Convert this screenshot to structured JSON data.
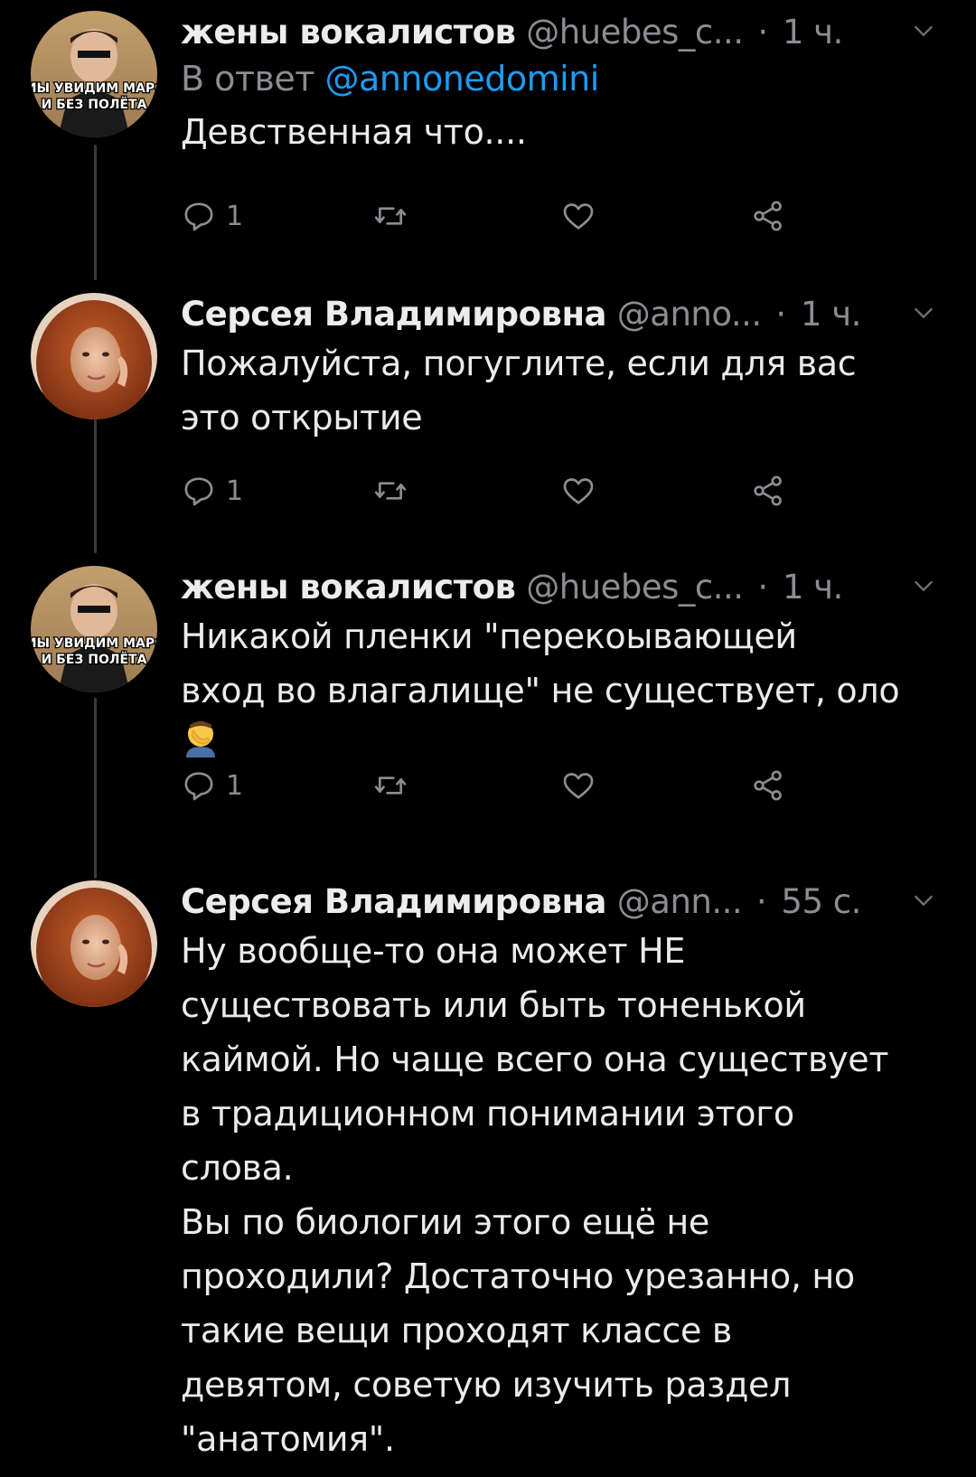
{
  "tweets": [
    {
      "name": "жены вокалистов",
      "handle": "@huebes_c...",
      "time": "1 ч.",
      "reply_to_prefix": "В ответ",
      "reply_to_handle": "@annonedomini",
      "text": "Девственная что....",
      "reply_count": "1",
      "avatar": "musk-meme-avatar",
      "avatar_caption": "МЫ УВИДИМ МАРС\nИ БЕЗ ПОЛЁТА"
    },
    {
      "name": "Серсея Владимировна",
      "handle": "@anno...",
      "time": "1 ч.",
      "text": "Пожалуйста, погуглите, если для вас\nэто открытие",
      "reply_count": "1",
      "avatar": "redhead-woman-avatar"
    },
    {
      "name": "жены вокалистов",
      "handle": "@huebes_c...",
      "time": "1 ч.",
      "text": "Никакой пленки \"перекоывающей\nвход во влагалище\" не существует, оло",
      "emoji": "facepalm-emoji",
      "reply_count": "1",
      "avatar": "musk-meme-avatar",
      "avatar_caption": "МЫ УВИДИМ МАРС\nИ БЕЗ ПОЛЁТА"
    },
    {
      "name": "Серсея Владимировна",
      "handle": "@ann...",
      "time": "55 с.",
      "text": "Ну вообще-то она может НЕ\nсуществовать или быть тоненькой\nкаймой. Но чаще всего она существует\nв традиционном понимании этого\nслова.\nВы по биологии этого ещё не\nпроходили? Достаточно урезанно, но\nтакие вещи проходят классе в\nдевятом, советую изучить раздел\n\"анатомия\".",
      "avatar": "redhead-woman-avatar"
    }
  ],
  "colors": {
    "background": "#000000",
    "text": "#ebebeb",
    "secondary": "#8b8d91",
    "link": "#1d9bf0",
    "thread_line": "#3a3a3a"
  },
  "icons": [
    "reply-icon",
    "retweet-icon",
    "like-icon",
    "share-icon",
    "chevron-down-icon"
  ]
}
